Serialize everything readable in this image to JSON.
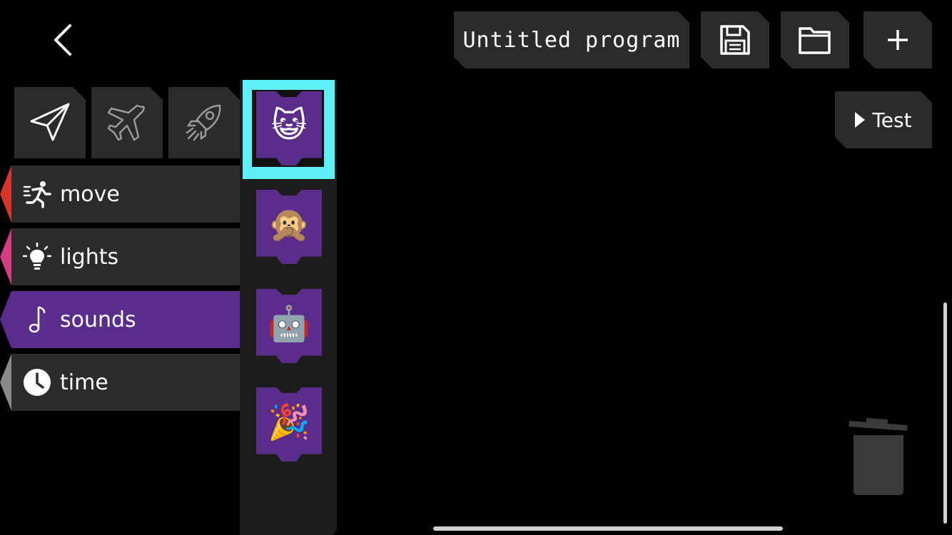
{
  "header": {
    "back_icon": "chevron-left-icon",
    "program_title": "Untitled program",
    "save_icon": "floppy-disk-icon",
    "open_icon": "folder-icon",
    "new_icon": "plus-icon",
    "test_label": "Test",
    "test_icon": "play-triangle-icon"
  },
  "vehicles": [
    {
      "icon": "paper-plane-icon",
      "selected": true
    },
    {
      "icon": "airplane-icon",
      "selected": false
    },
    {
      "icon": "rocket-icon",
      "selected": false
    }
  ],
  "categories": [
    {
      "label": "move",
      "icon": "running-person-icon",
      "color": "#d9342b"
    },
    {
      "label": "lights",
      "icon": "lightbulb-icon",
      "color": "#d63c84"
    },
    {
      "label": "sounds",
      "icon": "music-note-icon",
      "color": "#5b2d8b",
      "active": true
    },
    {
      "label": "time",
      "icon": "clock-icon",
      "color": "#8a8a8a"
    }
  ],
  "blocks": [
    {
      "emoji": "😺",
      "name": "cat-sound-block",
      "selected": true
    },
    {
      "emoji": "🙊",
      "name": "monkey-sound-block"
    },
    {
      "emoji": "🤖",
      "name": "robot-sound-block"
    },
    {
      "emoji": "🎉",
      "name": "party-sound-block"
    }
  ],
  "trash_icon": "trash-can-icon",
  "colors": {
    "accent": "#5b2d8b",
    "selection": "#5ef0f4",
    "chip": "#2b2b2b"
  }
}
